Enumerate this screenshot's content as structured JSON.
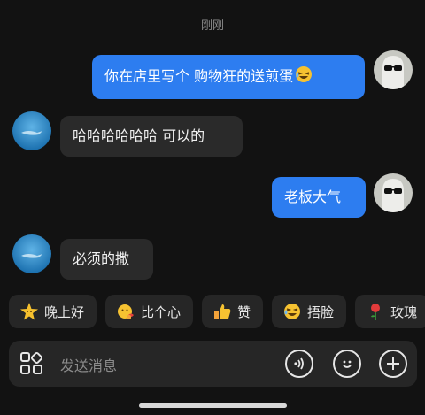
{
  "timestamp": "刚刚",
  "messages": [
    {
      "side": "out",
      "text": "你在店里写个 购物狂的送煎蛋",
      "emoji": "grinning-squint-emoji"
    },
    {
      "side": "in",
      "text": "哈哈哈哈哈哈 可以的"
    },
    {
      "side": "out",
      "text": "老板大气"
    },
    {
      "side": "in",
      "text": "必须的撒"
    }
  ],
  "quick_replies": [
    {
      "label": "晚上好",
      "icon": "sparkle-star-emoji"
    },
    {
      "label": "比个心",
      "icon": "finger-heart-emoji"
    },
    {
      "label": "赞",
      "icon": "thumbs-up-emoji"
    },
    {
      "label": "捂脸",
      "icon": "facepalm-emoji"
    },
    {
      "label": "玫瑰",
      "icon": "rose-emoji"
    }
  ],
  "input": {
    "placeholder": "发送消息"
  },
  "colors": {
    "outgoing_bubble": "#2d7df0",
    "incoming_bubble": "#2a2a2a",
    "background": "#121212"
  }
}
